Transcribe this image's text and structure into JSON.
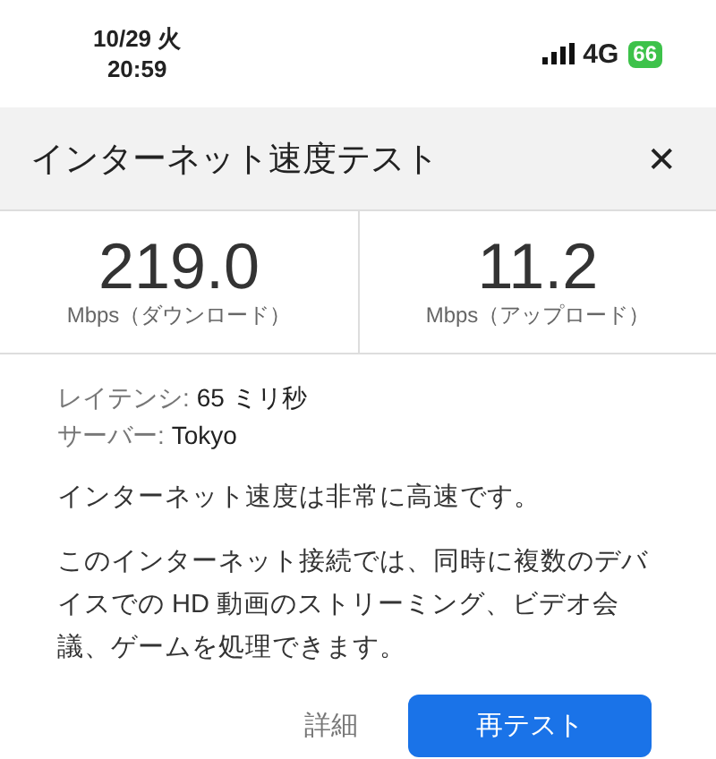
{
  "status_bar": {
    "date": "10/29 火",
    "time": "20:59",
    "network": "4G",
    "battery": "66"
  },
  "dialog": {
    "title": "インターネット速度テスト",
    "close": "✕",
    "results": [
      {
        "value": "219.0",
        "unit": "Mbps（ダウンロード）"
      },
      {
        "value": "11.2",
        "unit": "Mbps（アップロード）"
      }
    ],
    "details": [
      {
        "label": "レイテンシ:",
        "value": "65 ミリ秒"
      },
      {
        "label": "サーバー:",
        "value": "Tokyo"
      }
    ],
    "summary": "インターネット速度は非常に高速です。",
    "description": "このインターネット接続では、同時に複数のデバイスでの HD 動画のストリーミング、ビデオ会議、ゲームを処理できます。",
    "buttons": [
      {
        "label": "詳細",
        "kind": "text"
      },
      {
        "label": "再テスト",
        "kind": "primary"
      }
    ]
  }
}
